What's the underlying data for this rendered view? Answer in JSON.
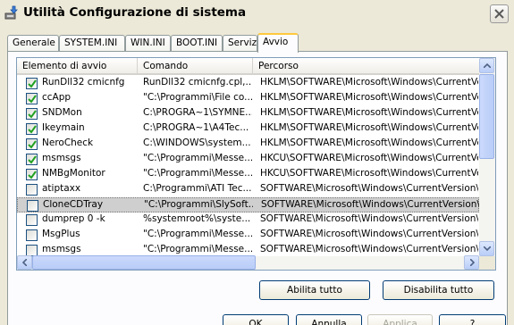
{
  "window": {
    "title": "Utilità Configurazione di sistema"
  },
  "tabs": [
    {
      "label": "Generale"
    },
    {
      "label": "SYSTEM.INI"
    },
    {
      "label": "WIN.INI"
    },
    {
      "label": "BOOT.INI"
    },
    {
      "label": "Servizi"
    },
    {
      "label": "Avvio",
      "active": true
    }
  ],
  "list": {
    "columns": [
      "Elemento di avvio",
      "Comando",
      "Percorso"
    ],
    "rows": [
      {
        "checked": true,
        "item": "RunDll32 cmicnfg",
        "command": "RunDll32 cmicnfg.cpl,...",
        "path": "HKLM\\SOFTWARE\\Microsoft\\Windows\\CurrentVer..."
      },
      {
        "checked": true,
        "item": "ccApp",
        "command": "\"C:\\Programmi\\File co...",
        "path": "HKLM\\SOFTWARE\\Microsoft\\Windows\\CurrentVer..."
      },
      {
        "checked": true,
        "item": "SNDMon",
        "command": "C:\\PROGRA~1\\SYMNE...",
        "path": "HKLM\\SOFTWARE\\Microsoft\\Windows\\CurrentVer..."
      },
      {
        "checked": true,
        "item": "Ikeymain",
        "command": "C:\\PROGRA~1\\A4Tec...",
        "path": "HKLM\\SOFTWARE\\Microsoft\\Windows\\CurrentVer..."
      },
      {
        "checked": true,
        "item": "NeroCheck",
        "command": "C:\\WINDOWS\\system...",
        "path": "HKLM\\SOFTWARE\\Microsoft\\Windows\\CurrentVer..."
      },
      {
        "checked": true,
        "item": "msmsgs",
        "command": "\"C:\\Programmi\\Messe...",
        "path": "HKCU\\SOFTWARE\\Microsoft\\Windows\\CurrentVer..."
      },
      {
        "checked": true,
        "item": "NMBgMonitor",
        "command": "\"C:\\Programmi\\Messe...",
        "path": "HKCU\\SOFTWARE\\Microsoft\\Windows\\CurrentVer..."
      },
      {
        "checked": false,
        "item": "atiptaxx",
        "command": "C:\\Programmi\\ATI Tec...",
        "path": "SOFTWARE\\Microsoft\\Windows\\CurrentVersion\\Ru"
      },
      {
        "checked": false,
        "item": "CloneCDTray",
        "command": "\"C:\\Programmi\\SlySoft...",
        "path": "SOFTWARE\\Microsoft\\Windows\\CurrentVersion\\Ru",
        "selected": true
      },
      {
        "checked": false,
        "item": "dumprep 0 -k",
        "command": "%systemroot%\\syste...",
        "path": "SOFTWARE\\Microsoft\\Windows\\CurrentVersion\\Ru"
      },
      {
        "checked": false,
        "item": "MsgPlus",
        "command": "\"C:\\Programmi\\Messe...",
        "path": "SOFTWARE\\Microsoft\\Windows\\CurrentVersion\\Ru"
      },
      {
        "checked": false,
        "item": "msmsgs",
        "command": "\"C:\\Programmi\\Messe...",
        "path": "SOFTWARE\\Microsoft\\Windows\\CurrentVersion\\Ru"
      }
    ]
  },
  "buttons": {
    "enable_all": "Abilita tutto",
    "disable_all": "Disabilita tutto",
    "ok": "OK",
    "cancel": "Annulla",
    "apply": "Applica",
    "help": "?"
  },
  "colors": {
    "window": "#ece9d8",
    "tab_highlight": "#ffc83c",
    "check": "#21a121",
    "scroll": "#c1d3fb"
  }
}
